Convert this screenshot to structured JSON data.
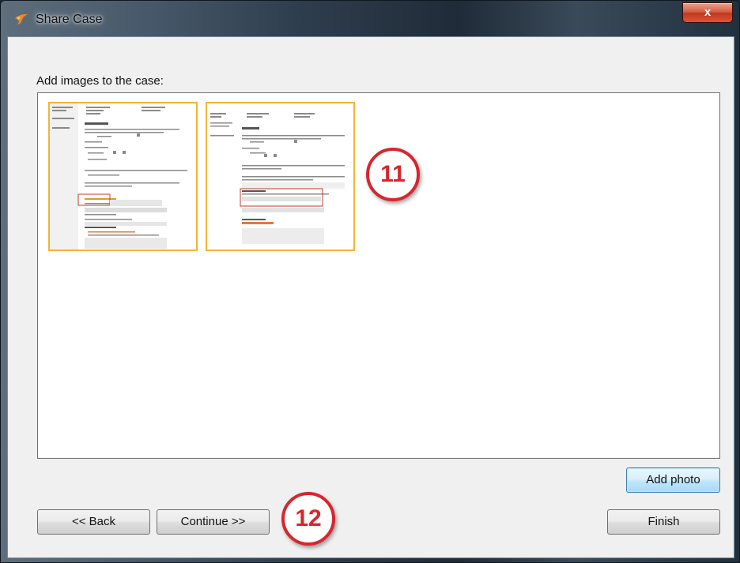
{
  "window": {
    "title": "Share Case",
    "close_label": "x",
    "app_icon": "app-logo-icon"
  },
  "main": {
    "instruction": "Add images to the case:"
  },
  "thumbnails": [
    {
      "name": "case-image-1",
      "border_color": "#f4b434"
    },
    {
      "name": "case-image-2",
      "border_color": "#f4b434"
    }
  ],
  "callouts": [
    "11",
    "12"
  ],
  "buttons": {
    "add_photo": "Add photo",
    "back": "<< Back",
    "continue": "Continue >>",
    "finish": "Finish"
  },
  "colors": {
    "accent_border": "#f4b434",
    "callout_red": "#d7262e",
    "primary_button": "#bee6fd"
  }
}
